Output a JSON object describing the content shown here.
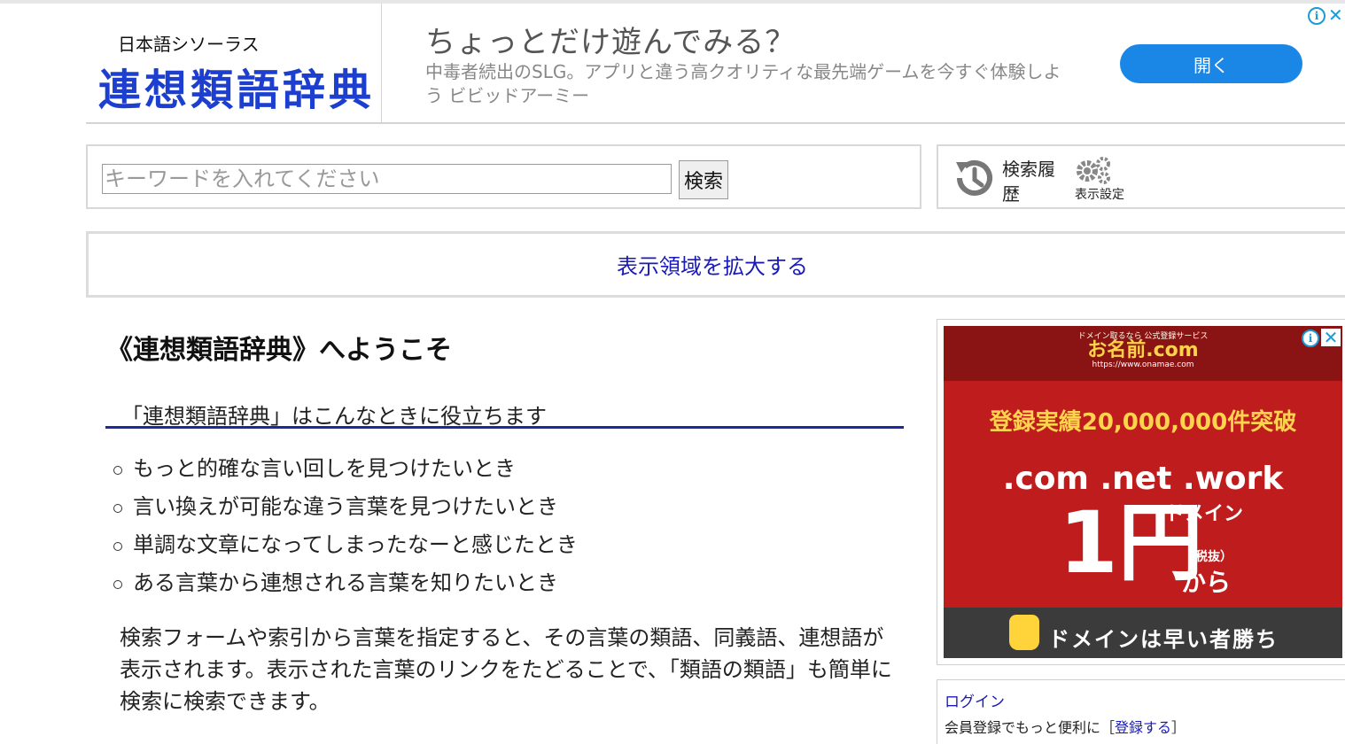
{
  "header": {
    "logo_sub": "日本語シソーラス",
    "logo_main": "連想類語辞典"
  },
  "top_ad": {
    "title": "ちょっとだけ遊んでみる？",
    "description": "中毒者続出のSLG。アプリと違う高クオリティな最先端ゲームを今すぐ体験しよう ビビッドアーミー",
    "button_label": "開く",
    "info_icon": "i",
    "close_icon": "✕"
  },
  "search": {
    "placeholder": "キーワードを入れてください",
    "value": "",
    "button_label": "検索"
  },
  "tools": {
    "history_label": "検索履歴",
    "settings_label": "表示設定"
  },
  "expand": {
    "link_label": "表示領域を拡大する"
  },
  "main": {
    "title": "《連想類語辞典》へようこそ",
    "section_heading": "「連想類語辞典」はこんなときに役立ちます",
    "uses": [
      "もっと的確な言い回しを見つけたいとき",
      "言い換えが可能な違う言葉を見つけたいとき",
      "単調な文章になってしまったなーと感じたとき",
      "ある言葉から連想される言葉を知りたいとき"
    ],
    "description": "検索フォームや索引から言葉を指定すると、その言葉の類語、同義語、連想語が表示されます。表示された言葉のリンクをたどることで、「類語の類語」も簡単に検索に検索できます。"
  },
  "side_ad": {
    "brand_small": "ドメイン取るなら 公式登録サービス",
    "brand_big": "お名前.com",
    "brand_url": "https://www.onamae.com",
    "record": "登録実績20,000,000件突破",
    "tlds": ".com .net .work",
    "domain_word": "ドメイン",
    "price": "1円",
    "tax": "（税抜）",
    "from": "から",
    "bottom_text": "ドメインは早い者勝ち",
    "info_icon": "i",
    "close_icon": "✕"
  },
  "login": {
    "link_label": "ログイン",
    "register_prefix": "会員登録でもっと便利に［",
    "register_link": "登録する",
    "register_suffix": "］"
  },
  "colors": {
    "accent_blue": "#1d3fd0",
    "link": "#1a1ab8",
    "ad_button": "#1a86e6",
    "ad_red": "#bf1d1d",
    "section_rule": "#1a2a9a"
  }
}
